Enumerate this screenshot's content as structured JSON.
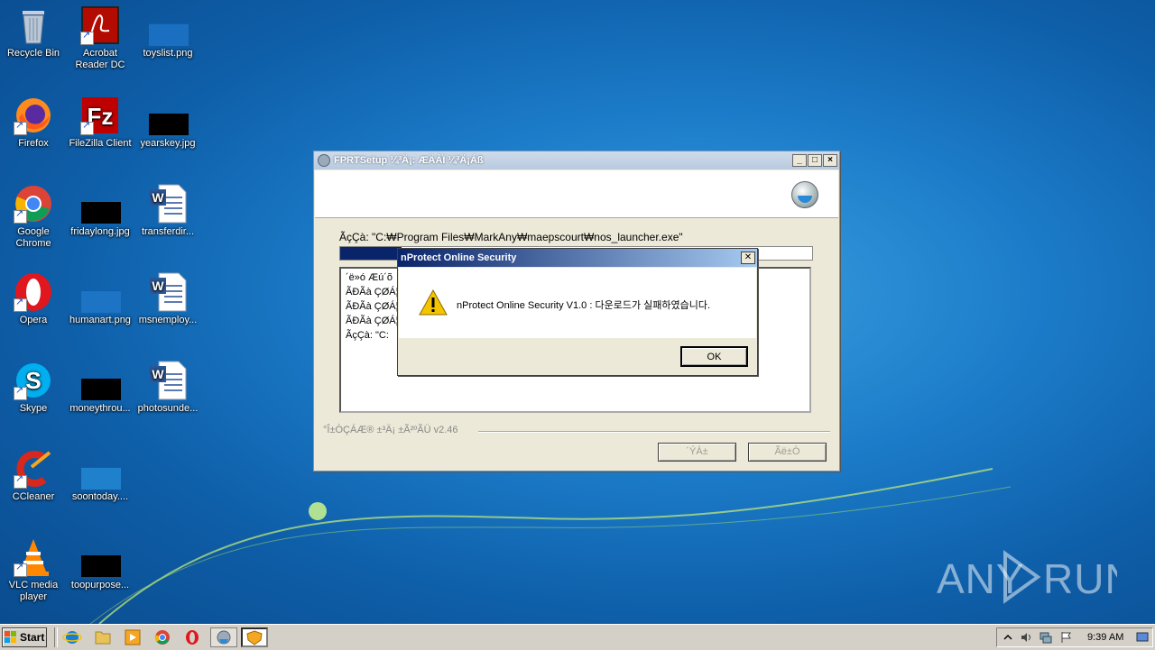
{
  "desktop": {
    "icons": [
      {
        "label": "Recycle Bin"
      },
      {
        "label": "Acrobat Reader DC"
      },
      {
        "label": "toyslist.png"
      },
      {
        "label": "Firefox"
      },
      {
        "label": "FileZilla Client"
      },
      {
        "label": "yearskey.jpg"
      },
      {
        "label": "Google Chrome"
      },
      {
        "label": "fridaylong.jpg"
      },
      {
        "label": "transferdir..."
      },
      {
        "label": "Opera"
      },
      {
        "label": "humanart.png"
      },
      {
        "label": "msnemploy..."
      },
      {
        "label": "Skype"
      },
      {
        "label": "moneythrou..."
      },
      {
        "label": "photosunde..."
      },
      {
        "label": "CCleaner"
      },
      {
        "label": "soontoday...."
      },
      {
        "label": "VLC media player"
      },
      {
        "label": "toopurpose..."
      }
    ],
    "watermark": "ANY RUN"
  },
  "setup_window": {
    "title": "FPRTSetup ¼³Ä¡: ÆÄÀÏ ¼³Ä¡Áß",
    "path_line": "ÃçÇà: \"C:₩Program Files₩MarkAny₩maepscourt₩nos_launcher.exe\"",
    "log_lines": [
      "´ë»ó Æú´õ",
      "ÃÐÃà ÇØÁ¦",
      "ÃÐÃà ÇØÁ¦",
      "ÃÐÃà ÇØÁ¦",
      "ÃçÇà: \"C:"
    ],
    "footer": "°Î±ÒÇÁÆ® ±³Ä¡ ±Ã²ºÃÜ v2.46",
    "back_button": "´ÝÀ±",
    "cancel_button": "Ãë±Ò"
  },
  "dialog": {
    "title": "nProtect Online Security",
    "message": "nProtect Online Security V1.0 : 다운로드가 실패하였습니다.",
    "ok_button": "OK",
    "close_symbol": "✕"
  },
  "taskbar": {
    "start_label": "Start",
    "clock": "9:39 AM"
  },
  "colors": {
    "dialog_title_start": "#0a246a",
    "dialog_title_end": "#a6caf0",
    "warning_yellow": "#f5c400",
    "progress_fill": "#0a246a"
  }
}
